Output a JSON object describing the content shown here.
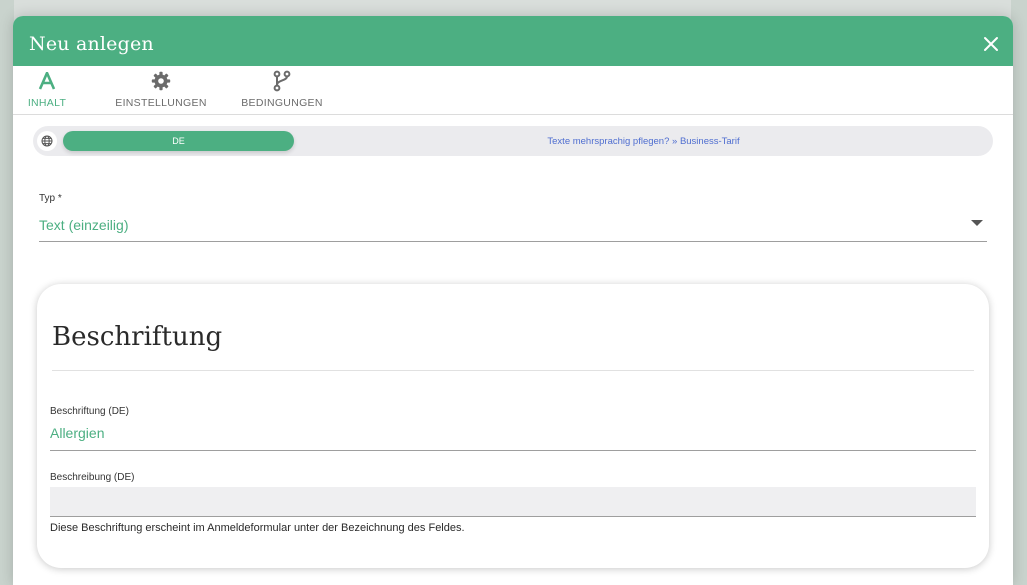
{
  "dialog": {
    "title": "Neu anlegen"
  },
  "tabs": [
    {
      "label": "INHALT",
      "icon": "text-format-icon",
      "active": true
    },
    {
      "label": "EINSTELLUNGEN",
      "icon": "gear-icon",
      "active": false
    },
    {
      "label": "BEDINGUNGEN",
      "icon": "branch-icon",
      "active": false
    }
  ],
  "language_bar": {
    "active_language": "DE",
    "upsell_link": "Texte mehrsprachig pflegen? » Business-Tarif"
  },
  "type_field": {
    "label": "Typ *",
    "value": "Text (einzeilig)"
  },
  "label_card": {
    "title": "Beschriftung",
    "label_field": {
      "label": "Beschriftung (DE)",
      "value": "Allergien"
    },
    "description_field": {
      "label": "Beschreibung (DE)",
      "value": "",
      "hint": "Diese Beschriftung erscheint im Anmeldeformular unter der Bezeichnung des Feldes."
    }
  },
  "colors": {
    "accent": "#4caf82",
    "link": "#4f6ed0",
    "text": "#2a2a2a"
  }
}
